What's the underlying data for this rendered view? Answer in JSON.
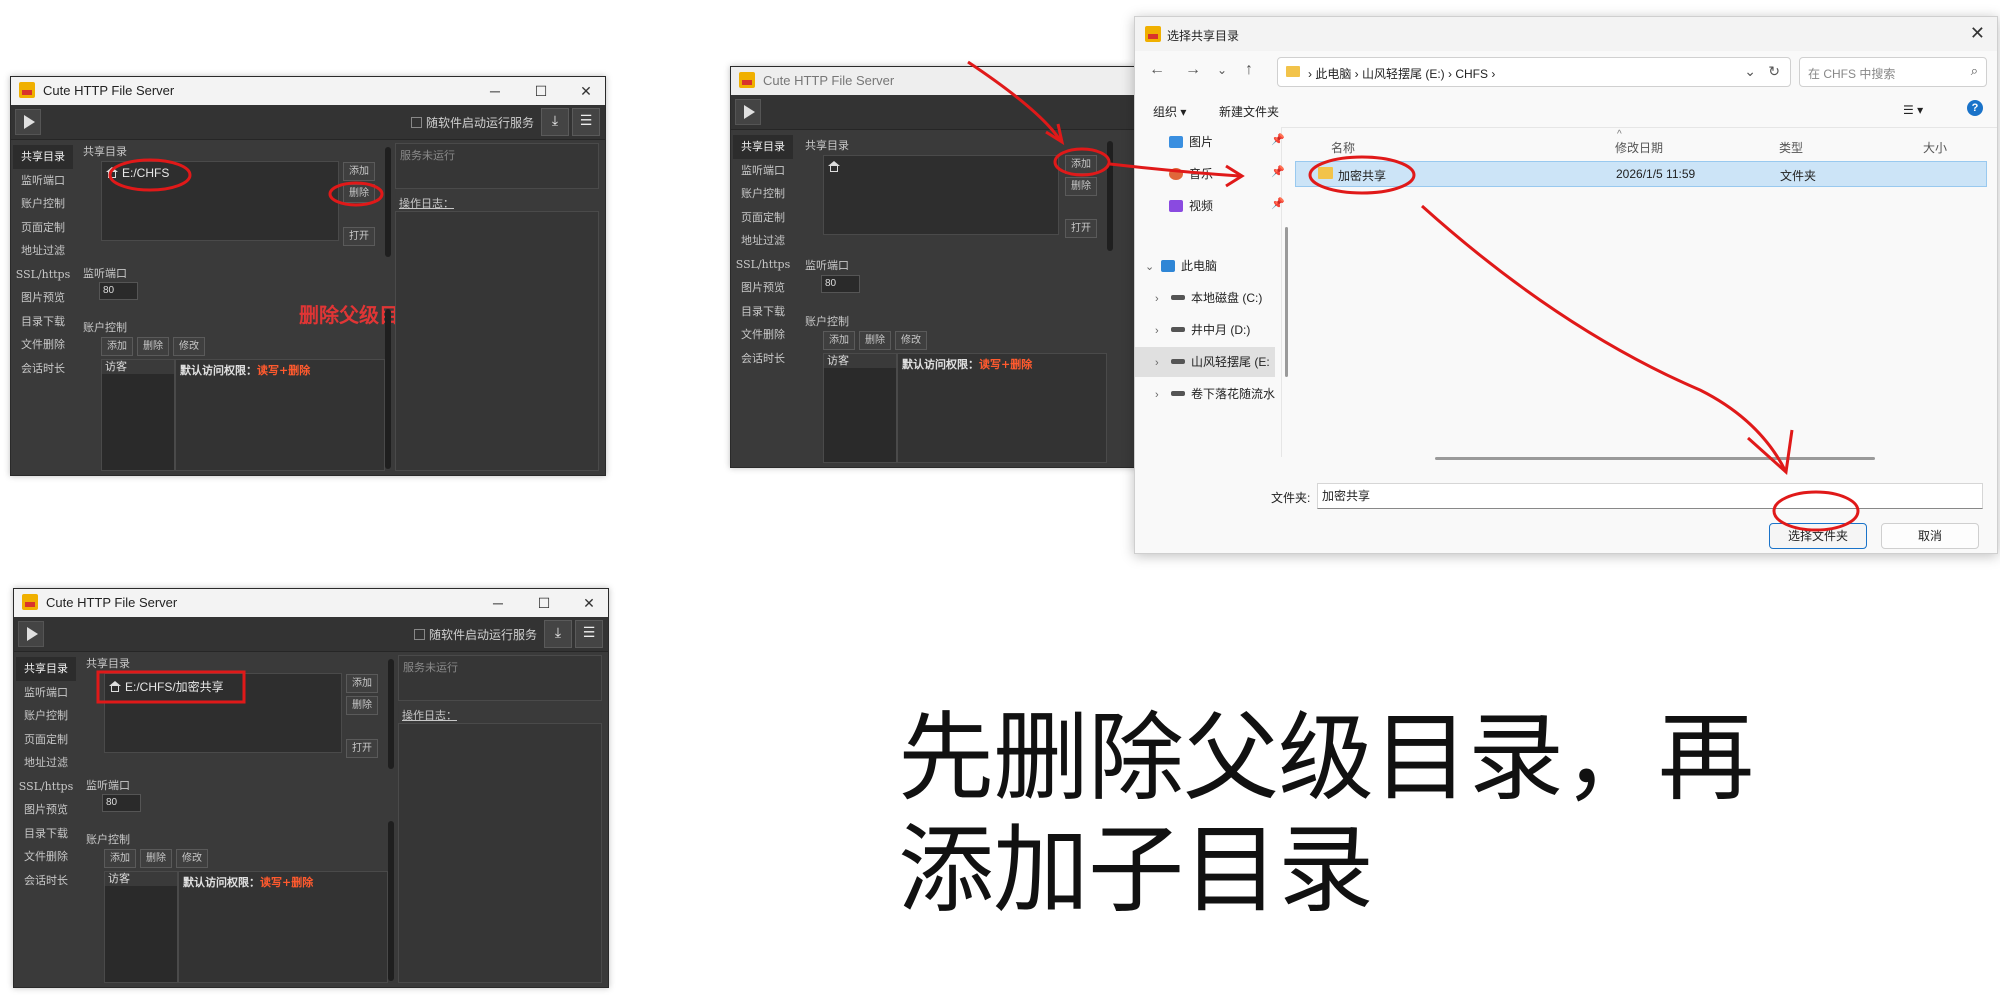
{
  "app": {
    "title": "Cute HTTP File Server",
    "minimize": "─",
    "maximize": "☐",
    "close": "✕",
    "autostart_label": "随软件启动运行服务",
    "download_icon": "download-icon",
    "menu_icon": "menu-icon",
    "sidebar": [
      "共享目录",
      "监听端口",
      "账户控制",
      "页面定制",
      "地址过滤",
      "SSL/https",
      "图片预览",
      "目录下载",
      "文件删除",
      "会话时长"
    ],
    "shared_dir_label": "共享目录",
    "add": "添加",
    "delete": "删除",
    "open": "打开",
    "port_label": "监听端口",
    "port_value": "80",
    "account_label": "账户控制",
    "acct_add": "添加",
    "acct_delete": "删除",
    "acct_modify": "修改",
    "guest": "访客",
    "perm_prefix": "默认访问权限：",
    "perm_value": "读写+删除",
    "status": "服务未运行",
    "log_label": "操作日志："
  },
  "panel1": {
    "path": "E:/CHFS",
    "annotation": "删除父级目录"
  },
  "panel3": {
    "path": "E:/CHFS/加密共享"
  },
  "dialog": {
    "title": "选择共享目录",
    "breadcrumb": "›  此电脑  ›  山风轻摆尾 (E:)  ›  CHFS  ›",
    "search_placeholder": "在 CHFS 中搜索",
    "organize": "组织 ▾",
    "new_folder": "新建文件夹",
    "view_icon": "☰ ▾",
    "help": "?",
    "nav": {
      "pictures": "图片",
      "music": "音乐",
      "videos": "视频",
      "this_pc": "此电脑",
      "drive_c": "本地磁盘 (C:)",
      "drive_d": "井中月 (D:)",
      "drive_e": "山风轻摆尾 (E:",
      "drive_f": "卷下落花随流水"
    },
    "columns": {
      "name": "名称",
      "modified": "修改日期",
      "type": "类型",
      "size": "大小"
    },
    "row": {
      "name": "加密共享",
      "modified": "2026/1/5 11:59",
      "type": "文件夹"
    },
    "folder_label": "文件夹:",
    "folder_value": "加密共享",
    "select_button": "选择文件夹",
    "cancel_button": "取消"
  },
  "instruction": {
    "line1": "先删除父级目录，再",
    "line2": "添加子目录"
  },
  "colors": {
    "accent_red": "#e01919",
    "dialog_blue": "#1a73c9",
    "app_bg": "#3a3a3a"
  }
}
